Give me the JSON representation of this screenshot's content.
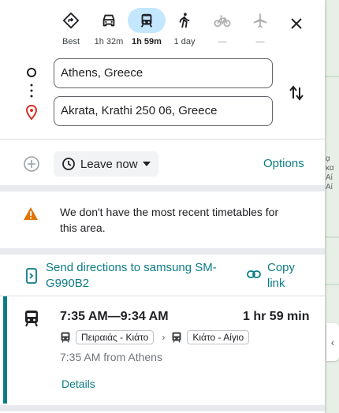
{
  "travel_modes": [
    {
      "name": "Best",
      "label": "Best",
      "icon": "best-route-icon",
      "active": false,
      "disabled": false
    },
    {
      "name": "Driving",
      "label": "1h 32m",
      "icon": "car-icon",
      "active": false,
      "disabled": false
    },
    {
      "name": "Transit",
      "label": "1h 59m",
      "icon": "train-icon",
      "active": true,
      "disabled": false
    },
    {
      "name": "Walking",
      "label": "1 day",
      "icon": "walking-icon",
      "active": false,
      "disabled": false
    },
    {
      "name": "Cycling",
      "label": "—",
      "icon": "bicycle-icon",
      "active": false,
      "disabled": true
    },
    {
      "name": "Flights",
      "label": "—",
      "icon": "airplane-icon",
      "active": false,
      "disabled": true
    }
  ],
  "origin": {
    "value": "Athens, Greece"
  },
  "destination": {
    "value": "Akrata, Krathi 250 06, Greece"
  },
  "leave_now": {
    "label": "Leave now"
  },
  "options_label": "Options",
  "warning": {
    "text": "We don't have the most recent timetables for this area."
  },
  "send_directions": {
    "label": "Send directions to samsung SM-G990B2"
  },
  "copy_link": {
    "label": "Copy link"
  },
  "route": {
    "time_range": "7:35 AM—9:34 AM",
    "duration": "1 hr 59 min",
    "legs": [
      "Πειραιάς - Κιάτο",
      "Κιάτο - Αίγιο"
    ],
    "from_text": "7:35 AM from Athens",
    "details_label": "Details"
  },
  "colors": {
    "accent": "#0b7c84",
    "active_mode_bg": "#c2e7ff",
    "warning": "#e37400",
    "destination_pin": "#d93025"
  }
}
